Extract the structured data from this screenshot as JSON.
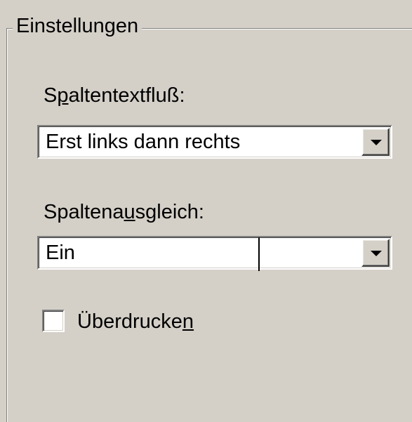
{
  "group": {
    "title": "Einstellungen"
  },
  "column_flow": {
    "label_pre": "S",
    "label_accel": "p",
    "label_post": "altentextfluß:",
    "value": "Erst links dann rechts"
  },
  "column_balance": {
    "label_pre": "Spaltena",
    "label_accel": "u",
    "label_post": "sgleich:",
    "value": "Ein"
  },
  "overprint": {
    "label_pre": "Überdrucke",
    "label_accel": "n",
    "checked": false
  },
  "icons": {
    "dropdown": "chevron-down-icon"
  }
}
